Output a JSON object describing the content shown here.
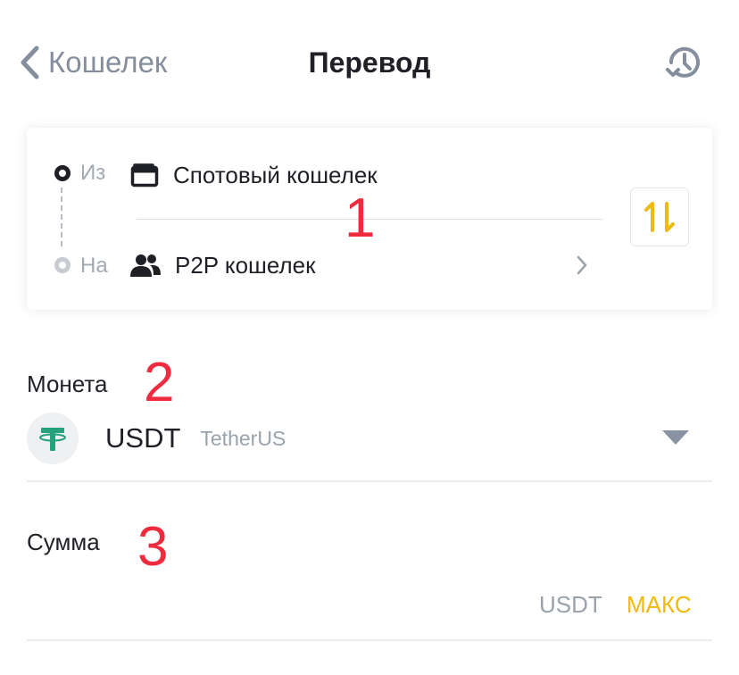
{
  "header": {
    "back_label": "Кошелек",
    "title": "Перевод",
    "back_icon": "chevron-left-icon",
    "history_icon": "history-icon"
  },
  "transfer": {
    "from_label": "Из",
    "to_label": "На",
    "from_wallet": "Спотовый кошелек",
    "to_wallet": "P2P кошелек",
    "from_icon": "wallet-icon",
    "to_icon": "users-icon",
    "swap_icon": "swap-arrows-icon"
  },
  "annotations": [
    "1",
    "2",
    "3"
  ],
  "coin": {
    "label": "Монета",
    "symbol": "USDT",
    "name": "TetherUS",
    "icon": "tether-icon"
  },
  "amount": {
    "label": "Сумма",
    "value": "",
    "unit": "USDT",
    "max_label": "МАКС"
  },
  "colors": {
    "accent": "#f0b90b",
    "text_primary": "#1e2026",
    "text_secondary": "#848e9c",
    "annotation_red": "#ef2c3f",
    "tether_green": "#26a17b"
  }
}
